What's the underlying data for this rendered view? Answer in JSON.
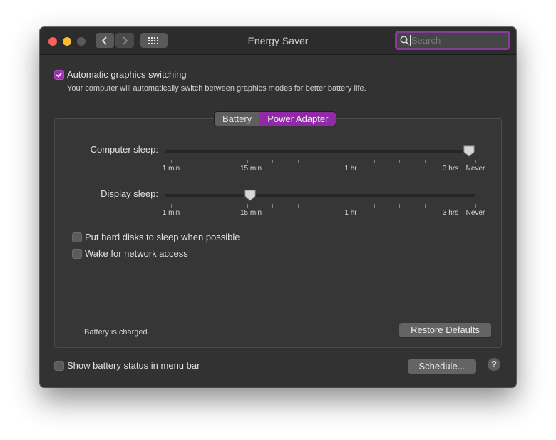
{
  "window": {
    "title": "Energy Saver"
  },
  "search": {
    "placeholder": "Search"
  },
  "graphics_switching": {
    "label": "Automatic graphics switching",
    "checked": true,
    "description": "Your computer will automatically switch between graphics modes for better battery life."
  },
  "tabs": [
    {
      "label": "Battery",
      "active": false
    },
    {
      "label": "Power Adapter",
      "active": true
    }
  ],
  "computer_sleep": {
    "label": "Computer sleep:",
    "value": "Never"
  },
  "display_sleep": {
    "label": "Display sleep:",
    "value": "15 min"
  },
  "tick_labels": [
    "1 min",
    "15 min",
    "1 hr",
    "3 hrs",
    "Never"
  ],
  "hard_disks": {
    "label": "Put hard disks to sleep when possible",
    "checked": false
  },
  "wake_network": {
    "label": "Wake for network access",
    "checked": false
  },
  "battery_status": "Battery is charged.",
  "restore_defaults": "Restore Defaults",
  "show_battery": {
    "label": "Show battery status in menu bar",
    "checked": false
  },
  "schedule": "Schedule...",
  "help": "?",
  "colors": {
    "accent": "#912aa6",
    "window_bg": "#323232"
  }
}
